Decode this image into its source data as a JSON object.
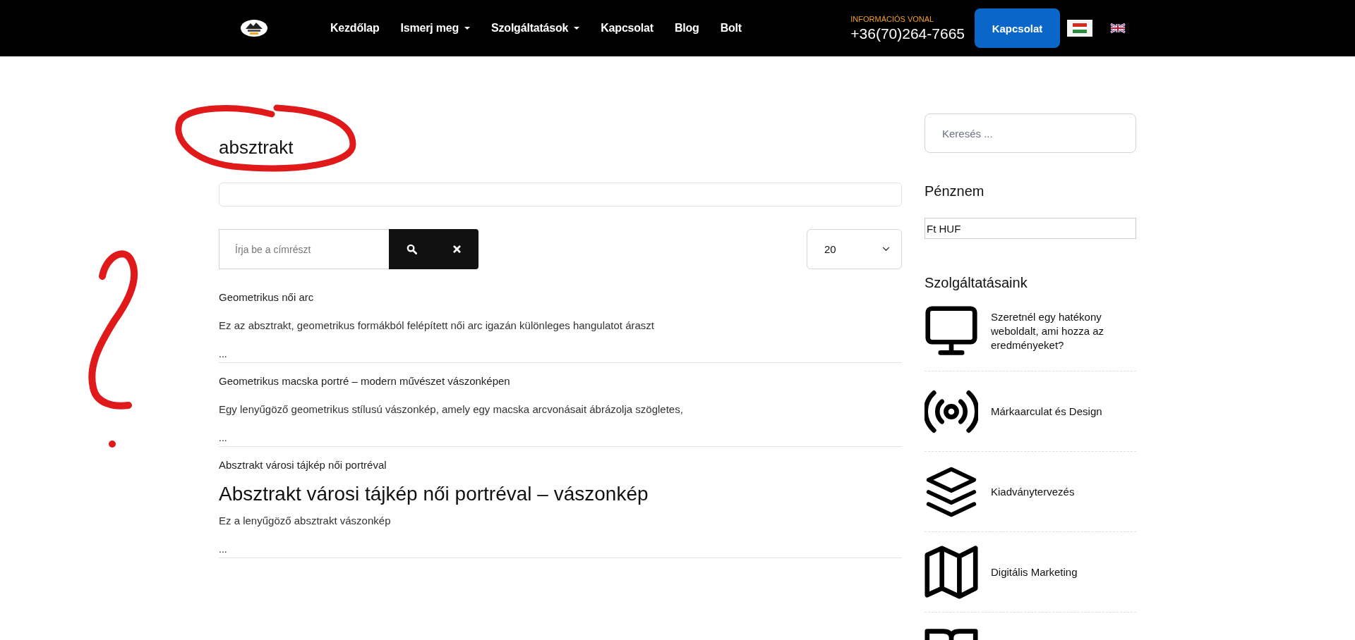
{
  "header": {
    "nav": [
      {
        "label": "Kezdőlap",
        "dropdown": false
      },
      {
        "label": "Ismerj meg",
        "dropdown": true
      },
      {
        "label": "Szolgáltatások",
        "dropdown": true
      },
      {
        "label": "Kapcsolat",
        "dropdown": false
      },
      {
        "label": "Blog",
        "dropdown": false
      },
      {
        "label": "Bolt",
        "dropdown": false
      }
    ],
    "info_label": "INFORMÁCIÓS VONAL",
    "phone": "+36(70)264-7665",
    "cta": "Kapcsolat",
    "languages": [
      {
        "kind": "hu",
        "selected": true
      },
      {
        "kind": "en",
        "selected": false
      }
    ]
  },
  "main": {
    "title": "absztrakt",
    "search": {
      "placeholder": "Írja be a címrészt"
    },
    "per_page": "20",
    "results": [
      {
        "title": "Geometrikus női arc",
        "excerpt": "Ez az absztrakt, geometrikus formákból felépített női arc igazán különleges hangulatot áraszt",
        "more": "..."
      },
      {
        "title": "Geometrikus macska portré – modern művészet vászonképen",
        "excerpt": "Egy lenyűgöző geometrikus stílusú vászonkép, amely egy macska arcvonásait ábrázolja szögletes,",
        "more": "..."
      },
      {
        "title": "Absztrakt városi tájkép női portréval",
        "heading": "Absztrakt városi tájkép női portréval – vászonkép",
        "excerpt": "Ez a lenyűgöző absztrakt vászonkép",
        "more": "..."
      }
    ]
  },
  "sidebar": {
    "search": {
      "placeholder": "Keresés ..."
    },
    "currency_title": "Pénznem",
    "currency": "Ft HUF",
    "services_title": "Szolgáltatásaink",
    "services": [
      {
        "kind": "monitor",
        "label": "Szeretnél egy hatékony weboldalt, ami hozza az eredményeket?"
      },
      {
        "kind": "broadcast",
        "label": "Márkaarculat és Design"
      },
      {
        "kind": "layers",
        "label": "Kiadványtervezés"
      },
      {
        "kind": "map",
        "label": "Digitális Marketing"
      },
      {
        "kind": "book"
      }
    ]
  }
}
